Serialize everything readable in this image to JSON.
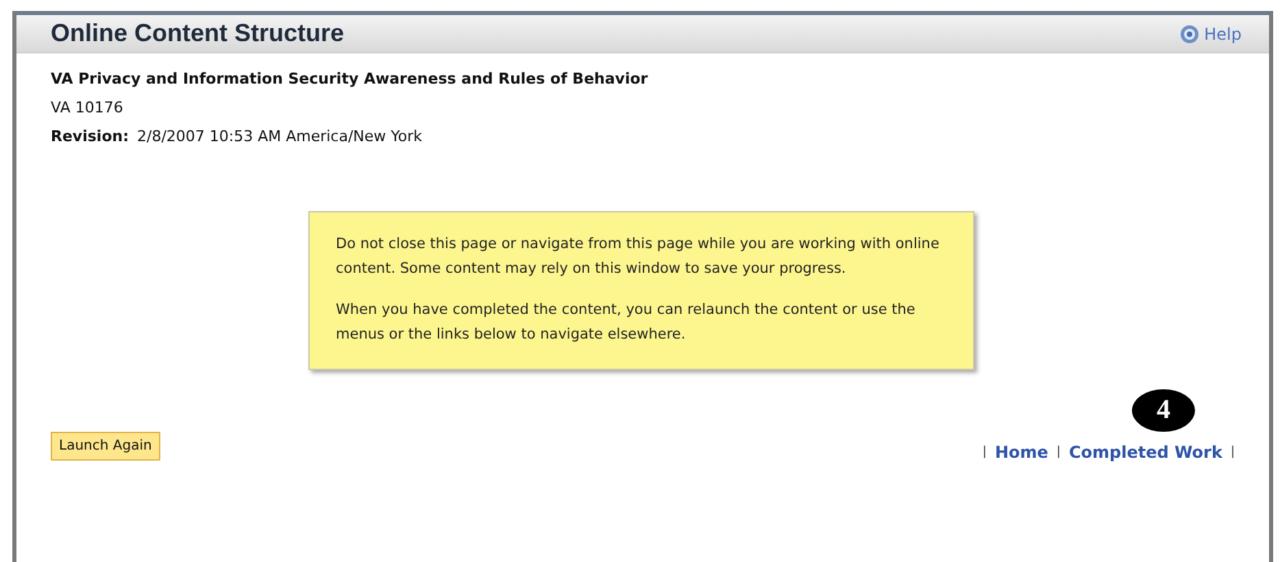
{
  "header": {
    "title": "Online Content Structure",
    "help": "Help"
  },
  "course": {
    "title": "VA Privacy and Information Security Awareness and Rules of Behavior",
    "code": "VA 10176",
    "revision_label": "Revision:",
    "revision": "2/8/2007 10:53 AM America/New York"
  },
  "notice": {
    "paragraphs": [
      "Do not close this page or navigate from this page while you are working with online content. Some content may rely on this window to save your progress.",
      "When you have completed the content, you can relaunch the content or use the menus or the links below to navigate elsewhere."
    ]
  },
  "launch_button": "Launch Again",
  "callout": "4",
  "nav": [
    {
      "kind": "separator",
      "text": "|"
    },
    {
      "kind": "link",
      "text": "Home"
    },
    {
      "kind": "separator",
      "text": "|"
    },
    {
      "kind": "link",
      "text": "Completed Work"
    },
    {
      "kind": "separator",
      "text": "|"
    }
  ]
}
